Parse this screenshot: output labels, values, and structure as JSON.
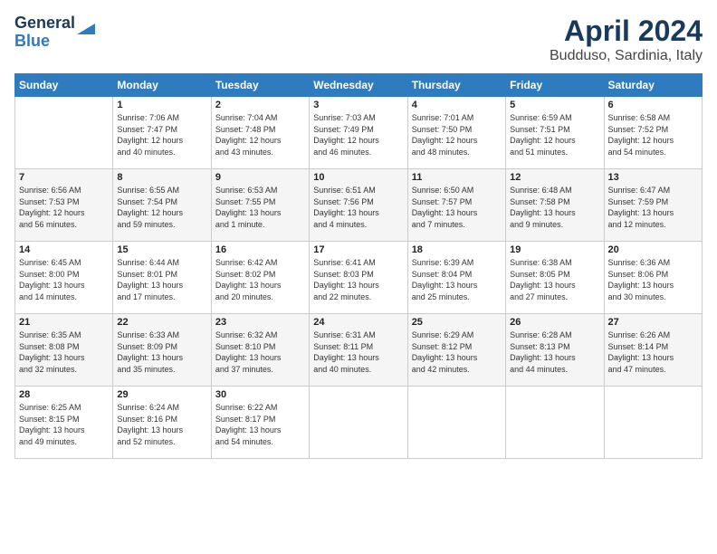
{
  "logo": {
    "line1": "General",
    "line2": "Blue"
  },
  "header": {
    "title": "April 2024",
    "subtitle": "Budduso, Sardinia, Italy"
  },
  "weekdays": [
    "Sunday",
    "Monday",
    "Tuesday",
    "Wednesday",
    "Thursday",
    "Friday",
    "Saturday"
  ],
  "weeks": [
    [
      {
        "day": "",
        "info": ""
      },
      {
        "day": "1",
        "info": "Sunrise: 7:06 AM\nSunset: 7:47 PM\nDaylight: 12 hours\nand 40 minutes."
      },
      {
        "day": "2",
        "info": "Sunrise: 7:04 AM\nSunset: 7:48 PM\nDaylight: 12 hours\nand 43 minutes."
      },
      {
        "day": "3",
        "info": "Sunrise: 7:03 AM\nSunset: 7:49 PM\nDaylight: 12 hours\nand 46 minutes."
      },
      {
        "day": "4",
        "info": "Sunrise: 7:01 AM\nSunset: 7:50 PM\nDaylight: 12 hours\nand 48 minutes."
      },
      {
        "day": "5",
        "info": "Sunrise: 6:59 AM\nSunset: 7:51 PM\nDaylight: 12 hours\nand 51 minutes."
      },
      {
        "day": "6",
        "info": "Sunrise: 6:58 AM\nSunset: 7:52 PM\nDaylight: 12 hours\nand 54 minutes."
      }
    ],
    [
      {
        "day": "7",
        "info": "Sunrise: 6:56 AM\nSunset: 7:53 PM\nDaylight: 12 hours\nand 56 minutes."
      },
      {
        "day": "8",
        "info": "Sunrise: 6:55 AM\nSunset: 7:54 PM\nDaylight: 12 hours\nand 59 minutes."
      },
      {
        "day": "9",
        "info": "Sunrise: 6:53 AM\nSunset: 7:55 PM\nDaylight: 13 hours\nand 1 minute."
      },
      {
        "day": "10",
        "info": "Sunrise: 6:51 AM\nSunset: 7:56 PM\nDaylight: 13 hours\nand 4 minutes."
      },
      {
        "day": "11",
        "info": "Sunrise: 6:50 AM\nSunset: 7:57 PM\nDaylight: 13 hours\nand 7 minutes."
      },
      {
        "day": "12",
        "info": "Sunrise: 6:48 AM\nSunset: 7:58 PM\nDaylight: 13 hours\nand 9 minutes."
      },
      {
        "day": "13",
        "info": "Sunrise: 6:47 AM\nSunset: 7:59 PM\nDaylight: 13 hours\nand 12 minutes."
      }
    ],
    [
      {
        "day": "14",
        "info": "Sunrise: 6:45 AM\nSunset: 8:00 PM\nDaylight: 13 hours\nand 14 minutes."
      },
      {
        "day": "15",
        "info": "Sunrise: 6:44 AM\nSunset: 8:01 PM\nDaylight: 13 hours\nand 17 minutes."
      },
      {
        "day": "16",
        "info": "Sunrise: 6:42 AM\nSunset: 8:02 PM\nDaylight: 13 hours\nand 20 minutes."
      },
      {
        "day": "17",
        "info": "Sunrise: 6:41 AM\nSunset: 8:03 PM\nDaylight: 13 hours\nand 22 minutes."
      },
      {
        "day": "18",
        "info": "Sunrise: 6:39 AM\nSunset: 8:04 PM\nDaylight: 13 hours\nand 25 minutes."
      },
      {
        "day": "19",
        "info": "Sunrise: 6:38 AM\nSunset: 8:05 PM\nDaylight: 13 hours\nand 27 minutes."
      },
      {
        "day": "20",
        "info": "Sunrise: 6:36 AM\nSunset: 8:06 PM\nDaylight: 13 hours\nand 30 minutes."
      }
    ],
    [
      {
        "day": "21",
        "info": "Sunrise: 6:35 AM\nSunset: 8:08 PM\nDaylight: 13 hours\nand 32 minutes."
      },
      {
        "day": "22",
        "info": "Sunrise: 6:33 AM\nSunset: 8:09 PM\nDaylight: 13 hours\nand 35 minutes."
      },
      {
        "day": "23",
        "info": "Sunrise: 6:32 AM\nSunset: 8:10 PM\nDaylight: 13 hours\nand 37 minutes."
      },
      {
        "day": "24",
        "info": "Sunrise: 6:31 AM\nSunset: 8:11 PM\nDaylight: 13 hours\nand 40 minutes."
      },
      {
        "day": "25",
        "info": "Sunrise: 6:29 AM\nSunset: 8:12 PM\nDaylight: 13 hours\nand 42 minutes."
      },
      {
        "day": "26",
        "info": "Sunrise: 6:28 AM\nSunset: 8:13 PM\nDaylight: 13 hours\nand 44 minutes."
      },
      {
        "day": "27",
        "info": "Sunrise: 6:26 AM\nSunset: 8:14 PM\nDaylight: 13 hours\nand 47 minutes."
      }
    ],
    [
      {
        "day": "28",
        "info": "Sunrise: 6:25 AM\nSunset: 8:15 PM\nDaylight: 13 hours\nand 49 minutes."
      },
      {
        "day": "29",
        "info": "Sunrise: 6:24 AM\nSunset: 8:16 PM\nDaylight: 13 hours\nand 52 minutes."
      },
      {
        "day": "30",
        "info": "Sunrise: 6:22 AM\nSunset: 8:17 PM\nDaylight: 13 hours\nand 54 minutes."
      },
      {
        "day": "",
        "info": ""
      },
      {
        "day": "",
        "info": ""
      },
      {
        "day": "",
        "info": ""
      },
      {
        "day": "",
        "info": ""
      }
    ]
  ]
}
